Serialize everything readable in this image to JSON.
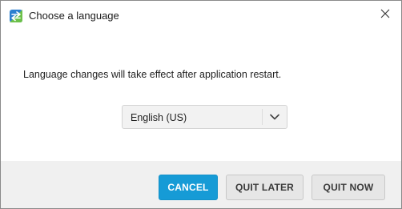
{
  "window": {
    "title": "Choose a language",
    "icons": {
      "app": "app-logo-icon",
      "close": "close-icon"
    }
  },
  "body": {
    "message": "Language changes will take effect after application restart."
  },
  "language_select": {
    "value": "English (US)",
    "icon": "chevron-down-icon"
  },
  "buttons": {
    "cancel": "CANCEL",
    "quit_later": "QUIT LATER",
    "quit_now": "QUIT NOW"
  },
  "colors": {
    "primary": "#169bd6",
    "secondary_button": "#e6e6e6",
    "footer": "#f0f0f0",
    "logo_blue": "#2b7fd0",
    "logo_green": "#6cc04a"
  }
}
